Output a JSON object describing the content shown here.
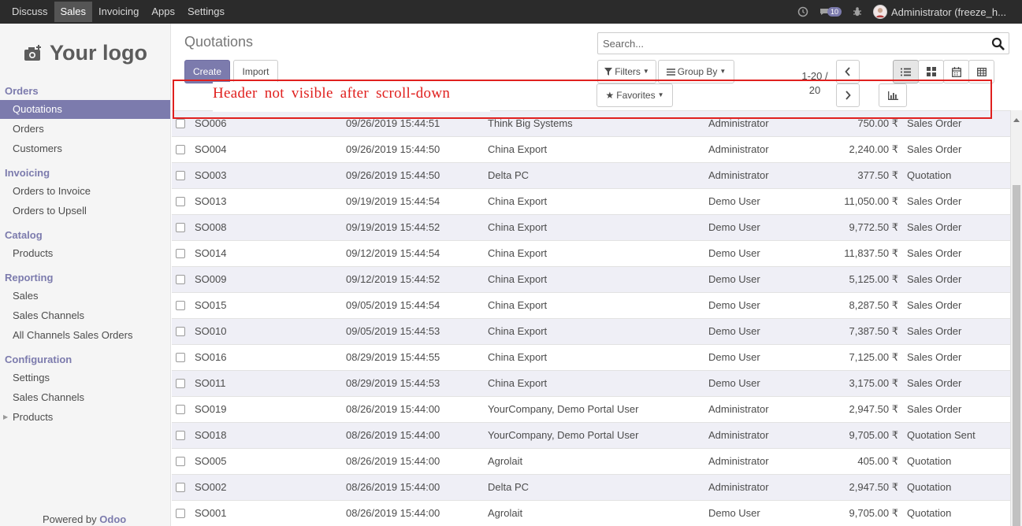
{
  "navbar": {
    "items": [
      "Discuss",
      "Sales",
      "Invoicing",
      "Apps",
      "Settings"
    ],
    "active": "Sales",
    "message_count": "10",
    "user": "Administrator (freeze_h..."
  },
  "sidebar": {
    "logo_text": "Your logo",
    "sections": [
      {
        "title": "Orders",
        "items": [
          "Quotations",
          "Orders",
          "Customers"
        ]
      },
      {
        "title": "Invoicing",
        "items": [
          "Orders to Invoice",
          "Orders to Upsell"
        ]
      },
      {
        "title": "Catalog",
        "items": [
          "Products"
        ]
      },
      {
        "title": "Reporting",
        "items": [
          "Sales",
          "Sales Channels",
          "All Channels Sales Orders"
        ]
      },
      {
        "title": "Configuration",
        "items": [
          "Settings",
          "Sales Channels",
          "Products"
        ]
      }
    ],
    "active_item": "Quotations",
    "powered_by": "Powered by",
    "powered_brand": "Odoo"
  },
  "control_panel": {
    "title": "Quotations",
    "create_label": "Create",
    "import_label": "Import",
    "search_placeholder": "Search...",
    "filters_label": "Filters",
    "group_by_label": "Group By",
    "favorites_label": "Favorites",
    "pager_range": "1-20 /",
    "pager_total": "20",
    "annotation": "Header not visible after scroll-down"
  },
  "colors": {
    "accent": "#7c7bad",
    "annotation": "#e0201e",
    "navbar": "#2b2b2b"
  },
  "rows": [
    {
      "number": "SO006",
      "date": "09/26/2019 15:44:51",
      "customer": "Think Big Systems",
      "salesperson": "Administrator",
      "total": "750.00 ₹",
      "status": "Sales Order"
    },
    {
      "number": "SO004",
      "date": "09/26/2019 15:44:50",
      "customer": "China Export",
      "salesperson": "Administrator",
      "total": "2,240.00 ₹",
      "status": "Sales Order"
    },
    {
      "number": "SO003",
      "date": "09/26/2019 15:44:50",
      "customer": "Delta PC",
      "salesperson": "Administrator",
      "total": "377.50 ₹",
      "status": "Quotation"
    },
    {
      "number": "SO013",
      "date": "09/19/2019 15:44:54",
      "customer": "China Export",
      "salesperson": "Demo User",
      "total": "11,050.00 ₹",
      "status": "Sales Order"
    },
    {
      "number": "SO008",
      "date": "09/19/2019 15:44:52",
      "customer": "China Export",
      "salesperson": "Demo User",
      "total": "9,772.50 ₹",
      "status": "Sales Order"
    },
    {
      "number": "SO014",
      "date": "09/12/2019 15:44:54",
      "customer": "China Export",
      "salesperson": "Demo User",
      "total": "11,837.50 ₹",
      "status": "Sales Order"
    },
    {
      "number": "SO009",
      "date": "09/12/2019 15:44:52",
      "customer": "China Export",
      "salesperson": "Demo User",
      "total": "5,125.00 ₹",
      "status": "Sales Order"
    },
    {
      "number": "SO015",
      "date": "09/05/2019 15:44:54",
      "customer": "China Export",
      "salesperson": "Demo User",
      "total": "8,287.50 ₹",
      "status": "Sales Order"
    },
    {
      "number": "SO010",
      "date": "09/05/2019 15:44:53",
      "customer": "China Export",
      "salesperson": "Demo User",
      "total": "7,387.50 ₹",
      "status": "Sales Order"
    },
    {
      "number": "SO016",
      "date": "08/29/2019 15:44:55",
      "customer": "China Export",
      "salesperson": "Demo User",
      "total": "7,125.00 ₹",
      "status": "Sales Order"
    },
    {
      "number": "SO011",
      "date": "08/29/2019 15:44:53",
      "customer": "China Export",
      "salesperson": "Demo User",
      "total": "3,175.00 ₹",
      "status": "Sales Order"
    },
    {
      "number": "SO019",
      "date": "08/26/2019 15:44:00",
      "customer": "YourCompany, Demo Portal User",
      "salesperson": "Administrator",
      "total": "2,947.50 ₹",
      "status": "Sales Order"
    },
    {
      "number": "SO018",
      "date": "08/26/2019 15:44:00",
      "customer": "YourCompany, Demo Portal User",
      "salesperson": "Administrator",
      "total": "9,705.00 ₹",
      "status": "Quotation Sent"
    },
    {
      "number": "SO005",
      "date": "08/26/2019 15:44:00",
      "customer": "Agrolait",
      "salesperson": "Administrator",
      "total": "405.00 ₹",
      "status": "Quotation"
    },
    {
      "number": "SO002",
      "date": "08/26/2019 15:44:00",
      "customer": "Delta PC",
      "salesperson": "Administrator",
      "total": "2,947.50 ₹",
      "status": "Quotation"
    },
    {
      "number": "SO001",
      "date": "08/26/2019 15:44:00",
      "customer": "Agrolait",
      "salesperson": "Demo User",
      "total": "9,705.00 ₹",
      "status": "Quotation"
    }
  ]
}
